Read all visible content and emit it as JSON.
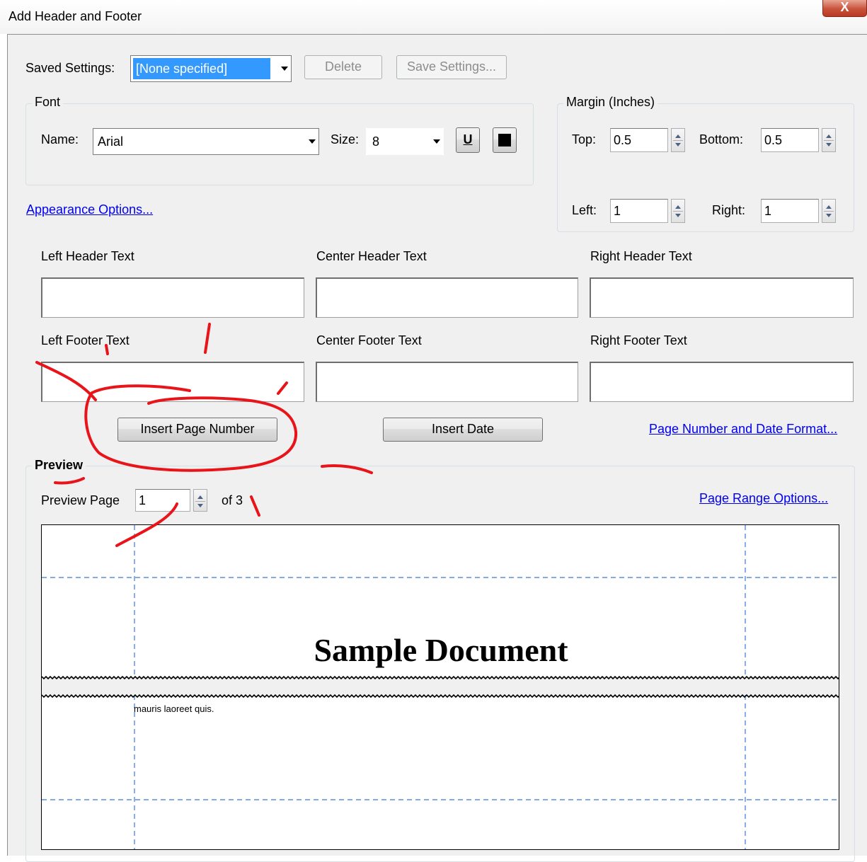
{
  "window": {
    "title": "Add Header and Footer",
    "close_glyph": "X"
  },
  "saved_settings": {
    "label": "Saved Settings:",
    "value": "[None specified]",
    "delete_label": "Delete",
    "save_label": "Save Settings..."
  },
  "font": {
    "legend": "Font",
    "name_label": "Name:",
    "name_value": "Arial",
    "size_label": "Size:",
    "size_value": "8",
    "underline_glyph": "U"
  },
  "appearance_link": "Appearance Options...",
  "margin": {
    "legend": "Margin (Inches)",
    "top_label": "Top:",
    "top_value": "0.5",
    "bottom_label": "Bottom:",
    "bottom_value": "0.5",
    "left_label": "Left:",
    "left_value": "1",
    "right_label": "Right:",
    "right_value": "1"
  },
  "header_fields": {
    "left": "Left Header Text",
    "center": "Center Header Text",
    "right": "Right Header Text"
  },
  "footer_fields": {
    "left": "Left Footer Text",
    "center": "Center Footer Text",
    "right": "Right Footer Text"
  },
  "insert_page_number_label": "Insert Page Number",
  "insert_date_label": "Insert Date",
  "page_number_format_link": "Page Number and Date Format...",
  "preview": {
    "legend": "Preview",
    "page_label": "Preview Page",
    "page_value": "1",
    "of_label": "of 3",
    "range_link": "Page Range Options...",
    "document_title": "Sample Document",
    "body_text": "mauris laoreet quis."
  },
  "colors": {
    "annotation": "#e8141a",
    "guide": "#3b78d8",
    "link": "#0000ee"
  }
}
